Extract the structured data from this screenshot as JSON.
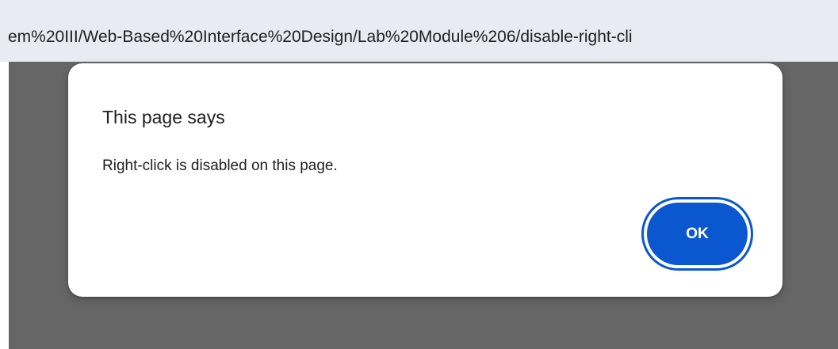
{
  "address_bar": {
    "url_text": "em%20III/Web-Based%20Interface%20Design/Lab%20Module%206/disable-right-cli"
  },
  "dialog": {
    "title": "This page says",
    "message": "Right-click is disabled on this page.",
    "ok_label": "OK"
  },
  "colors": {
    "accent": "#0b57d0",
    "overlay": "#666666",
    "address_bar_bg": "#e8ebf3"
  }
}
